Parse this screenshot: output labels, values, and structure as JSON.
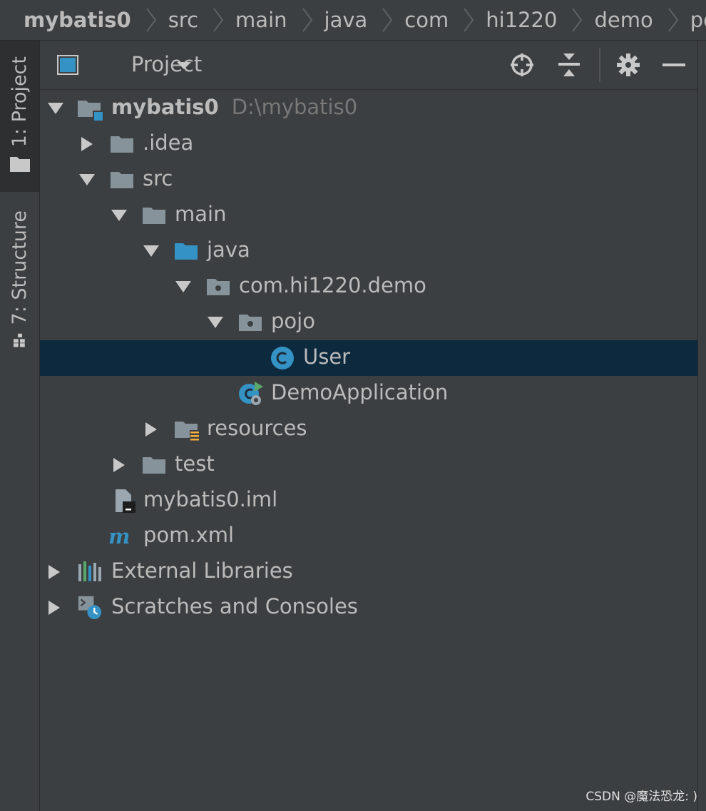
{
  "breadcrumbs": [
    "mybatis0",
    "src",
    "main",
    "java",
    "com",
    "hi1220",
    "demo",
    "pojo"
  ],
  "left_strip": {
    "project_tab": "1: Project",
    "structure_tab": "7: Structure"
  },
  "panel": {
    "title": "Project"
  },
  "tree": {
    "root": {
      "label": "mybatis0",
      "path": "D:\\mybatis0"
    },
    "idea": ".idea",
    "src": "src",
    "main": "main",
    "java": "java",
    "package": "com.hi1220.demo",
    "pojo": "pojo",
    "user": "User",
    "demo_app": "DemoApplication",
    "resources": "resources",
    "test": "test",
    "iml": "mybatis0.iml",
    "pom": "pom.xml",
    "ext_libs": "External Libraries",
    "scratches": "Scratches and Consoles"
  },
  "watermark": "CSDN @魔法恐龙: )",
  "colors": {
    "background": "#3c3f41",
    "selection": "#0d293e",
    "text": "#bbbbbb",
    "accent_blue": "#3592c4",
    "folder_gray": "#87939a"
  }
}
